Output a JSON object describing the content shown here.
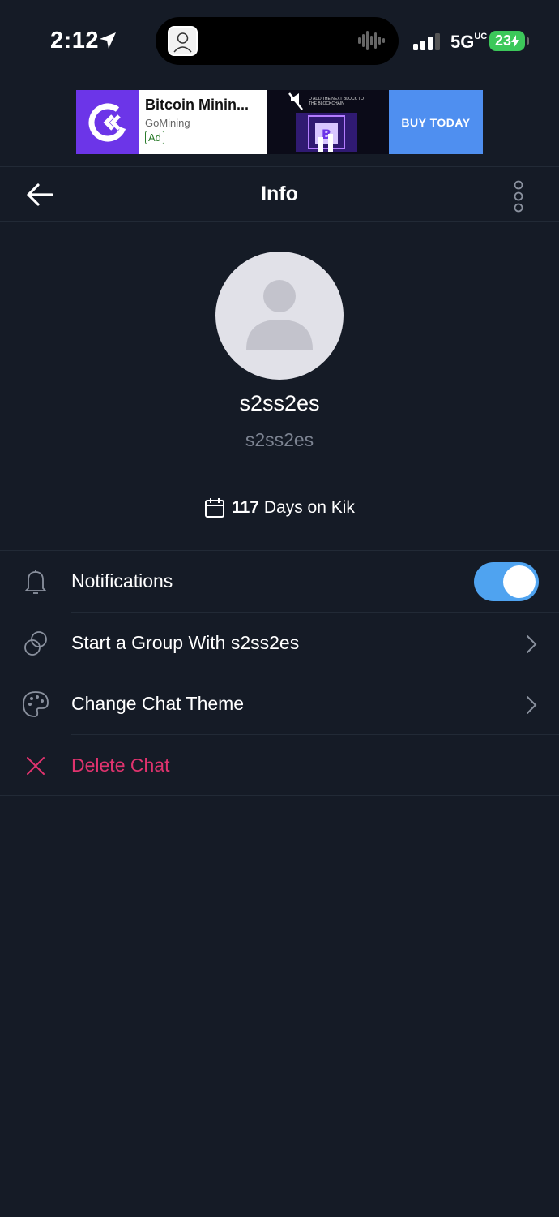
{
  "status_bar": {
    "time": "2:12",
    "network": "5G",
    "network_sup": "UC",
    "battery": "23",
    "icons": [
      "location-icon",
      "signal-icon",
      "waveform-icon",
      "charging-icon"
    ]
  },
  "ad": {
    "title": "Bitcoin Minin...",
    "advertiser": "GoMining",
    "badge": "Ad",
    "image_caption": "O ADD THE NEXT BLOCK TO THE BLOCKCHAIN",
    "cta": "BUY TODAY",
    "brand_color": "#6c35e8",
    "cta_color": "#4f8ff0"
  },
  "nav": {
    "title": "Info",
    "icons": [
      "back-arrow-icon",
      "more-vertical-icon"
    ]
  },
  "profile": {
    "display_name": "s2ss2es",
    "username": "s2ss2es",
    "days_count": "117",
    "days_label": "Days on Kik"
  },
  "menu": {
    "notifications": {
      "label": "Notifications",
      "icon": "bell-icon",
      "enabled": true
    },
    "start_group": {
      "label": "Start a Group With s2ss2es",
      "icon": "group-icon"
    },
    "change_theme": {
      "label": "Change Chat Theme",
      "icon": "palette-icon"
    },
    "delete_chat": {
      "label": "Delete Chat",
      "icon": "close-icon",
      "color": "#e0336e"
    }
  },
  "colors": {
    "background": "#151b26",
    "accent": "#4fa3f0",
    "muted_text": "#7c8391"
  }
}
